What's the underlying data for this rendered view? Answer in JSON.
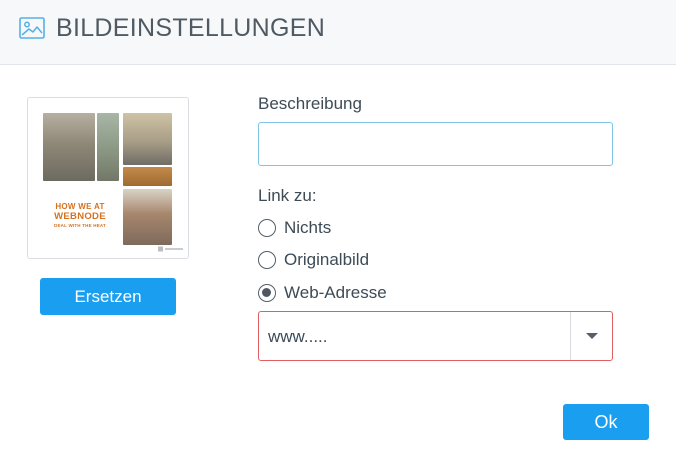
{
  "dialog": {
    "title": "BILDEINSTELLUNGEN",
    "icon": "image-icon"
  },
  "image_preview": {
    "headline_line1": "HOW WE AT",
    "headline_line2": "WEBNODE",
    "headline_line3": "DEAL WITH THE HEAT",
    "accent_color": "#d4721f"
  },
  "replace_button": {
    "label": "Ersetzen"
  },
  "description": {
    "label": "Beschreibung",
    "value": "",
    "placeholder": ""
  },
  "link": {
    "label": "Link zu:",
    "options": [
      {
        "label": "Nichts",
        "checked": false
      },
      {
        "label": "Originalbild",
        "checked": false
      },
      {
        "label": "Web-Adresse",
        "checked": true
      }
    ],
    "url_value": "www.....",
    "url_dropdown_icon": "chevron-down-icon"
  },
  "ok_button": {
    "label": "Ok"
  },
  "colors": {
    "primary": "#1a9ef0",
    "error_border": "#e06060",
    "focus_border": "#7fc3ea"
  }
}
